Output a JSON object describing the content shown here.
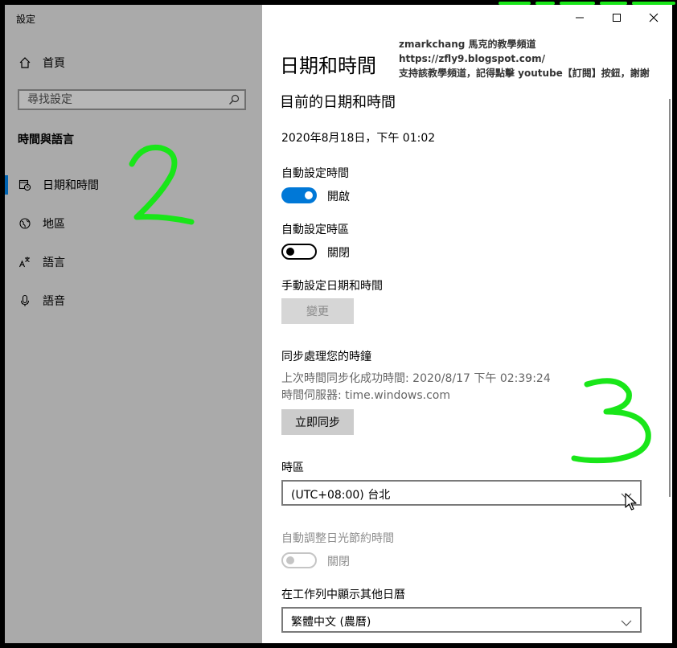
{
  "window": {
    "app_title": "設定"
  },
  "sidebar": {
    "home": "首頁",
    "search_placeholder": "尋找設定",
    "section": "時間與語言",
    "items": [
      {
        "label": "日期和時間",
        "icon": "calendar-clock-icon",
        "active": true
      },
      {
        "label": "地區",
        "icon": "globe-icon",
        "active": false
      },
      {
        "label": "語言",
        "icon": "language-icon",
        "active": false
      },
      {
        "label": "語音",
        "icon": "microphone-icon",
        "active": false
      }
    ]
  },
  "main": {
    "title": "日期和時間",
    "section_title": "目前的日期和時間",
    "current_datetime": "2020年8月18日，下午 01:02",
    "auto_time": {
      "label": "自動設定時間",
      "state": "開啟"
    },
    "auto_timezone": {
      "label": "自動設定時區",
      "state": "關閉"
    },
    "manual": {
      "label": "手動設定日期和時間",
      "button": "變更"
    },
    "sync": {
      "label": "同步處理您的時鐘",
      "last_sync": "上次時間同步化成功時間: 2020/8/17 下午 02:39:24",
      "server": "時間伺服器: time.windows.com",
      "button": "立即同步"
    },
    "timezone": {
      "label": "時區",
      "value": "(UTC+08:00) 台北"
    },
    "dst": {
      "label": "自動調整日光節約時間",
      "state": "關閉"
    },
    "calendar": {
      "label": "在工作列中顯示其他日曆",
      "value": "繁體中文 (農曆)"
    }
  },
  "watermark": {
    "line1": "zmarkchang 馬克的教學頻道",
    "line2": "https://zfly9.blogspot.com/",
    "line3": "支持該教學頻道，記得點擊 youtube【訂閱】按鈕，謝謝"
  },
  "colors": {
    "accent": "#0078d7",
    "sidebar_bg": "#aaaaaa",
    "annotation": "#19e619"
  }
}
